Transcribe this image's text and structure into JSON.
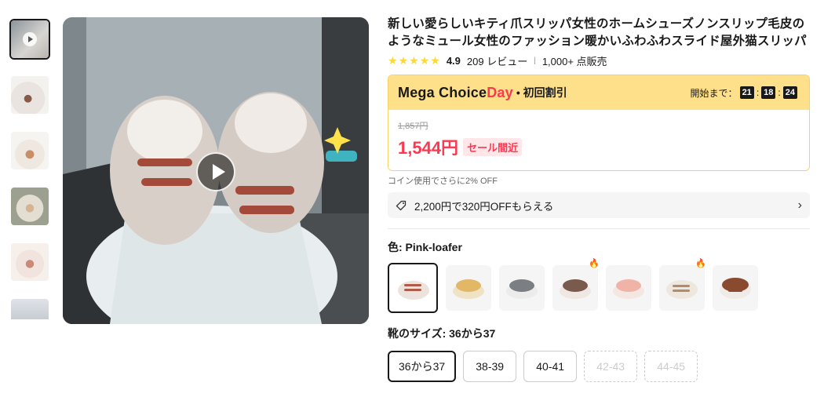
{
  "title": "新しい愛らしいキティ爪スリッパ女性のホームシューズノンスリップ毛皮のようなミュール女性のファッション暖かいふわふわスライド屋外猫スリッパ",
  "rating": {
    "score": "4.9",
    "reviews": "209 レビュー",
    "sold": "1,000+ 点販売"
  },
  "promo": {
    "brand_main": "Mega Choice",
    "brand_accent": "Day",
    "subtitle": "• 初回割引",
    "countdown_label": "開始まで：",
    "hours": "21",
    "minutes": "18",
    "seconds": "24",
    "colon": ":"
  },
  "price": {
    "old": "1,857円",
    "current": "1,544円",
    "tag": "セール間近"
  },
  "coin_note": "コイン使用でさらに2% OFF",
  "coupon": {
    "text": "2,200円で320円OFFもらえる"
  },
  "color": {
    "label": "色: Pink-loafer"
  },
  "size": {
    "label": "靴のサイズ: 36から37",
    "options": [
      "36から37",
      "38-39",
      "40-41",
      "42-43",
      "44-45"
    ]
  },
  "colors": {
    "accent": "#fd384f",
    "promo_bg": "#ffe08a",
    "star": "#fdd835"
  }
}
